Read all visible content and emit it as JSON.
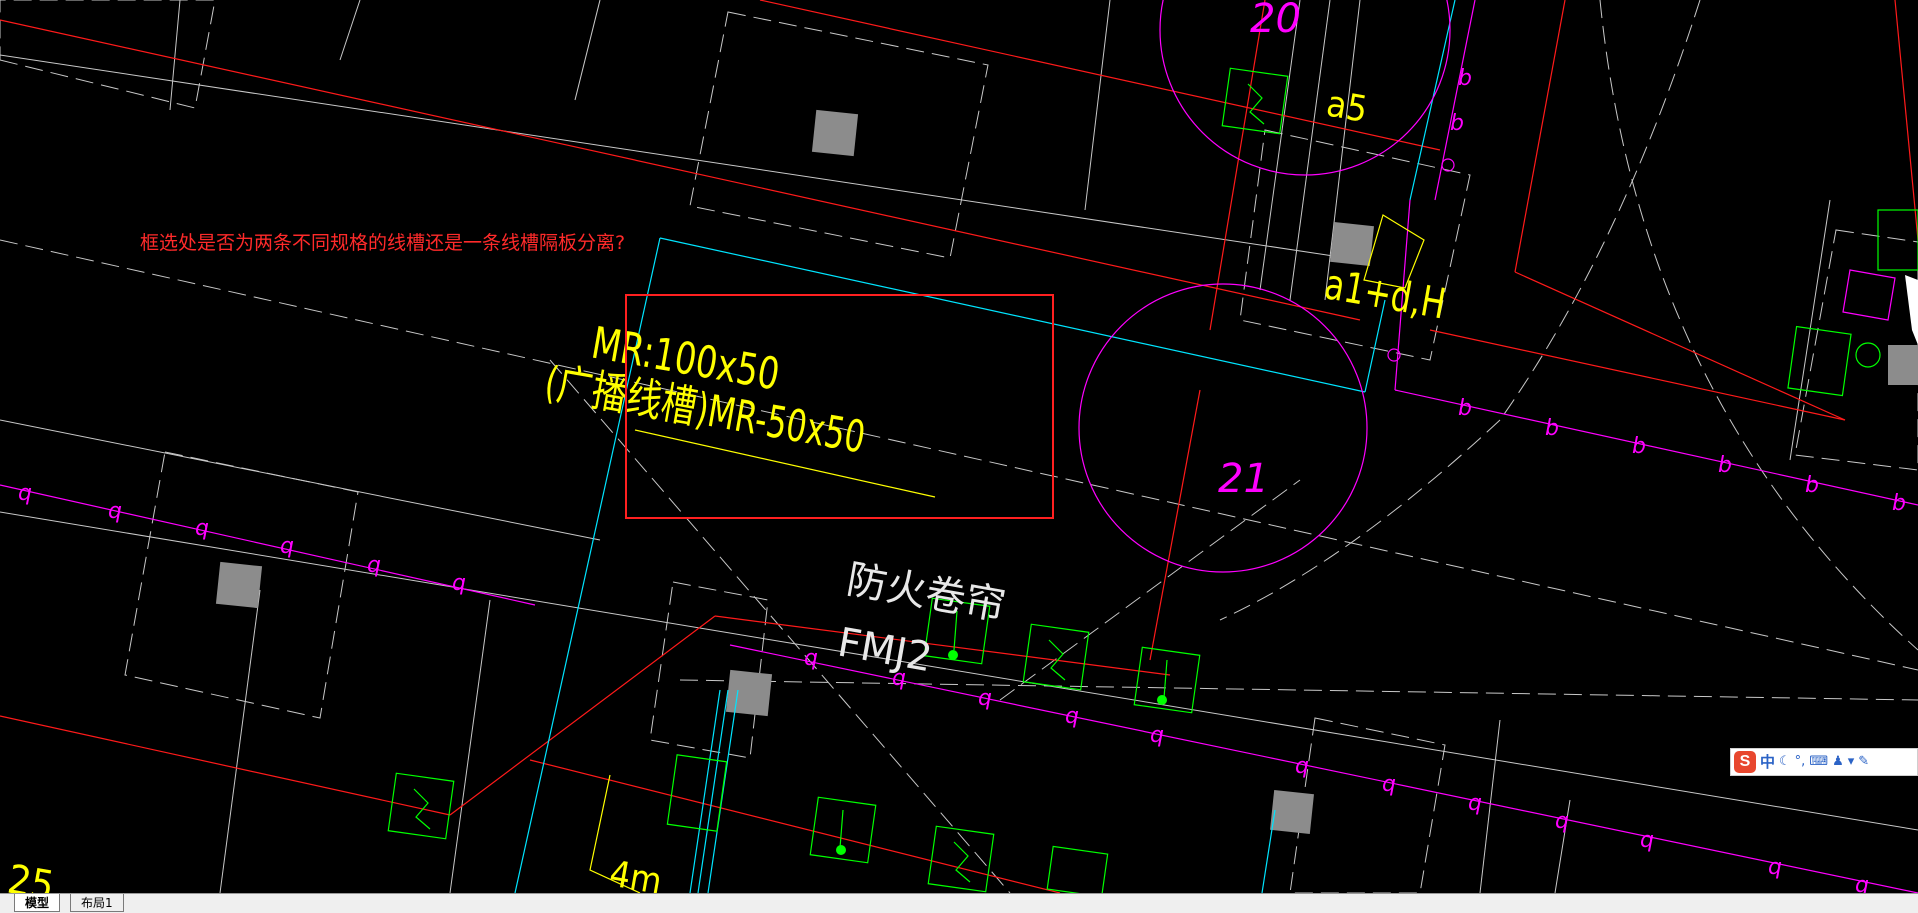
{
  "annotation": {
    "question": "框选处是否为两条不同规格的线槽还是一条线槽隔板分离?",
    "question_color": "#ff2a2a",
    "box_color": "#ff2020"
  },
  "drawing_labels": {
    "tray_main": "MR:100x50",
    "tray_broadcast": "(广播线槽)MR-50x50",
    "fire_shutter": "防火卷帘",
    "fire_shutter_code": "FMJ2",
    "room_21": "21",
    "room_20": "20",
    "tag_a5": "a5",
    "tag_a1dH": "a1+d,H",
    "height_4m": "4m",
    "room_25": "25",
    "line_marker_q": "q",
    "line_marker_b": "b"
  },
  "colors": {
    "background": "#000000",
    "white_line": "#c8c8c8",
    "red_line": "#ff1a1a",
    "magenta_line": "#ff00ff",
    "cyan_line": "#00e5ff",
    "yellow_text": "#ffff00",
    "green_symbol": "#00ff00",
    "gray_column": "#8c8c8c"
  },
  "tabs": [
    {
      "label": "模型",
      "active": true
    },
    {
      "label": "布局1",
      "active": false
    }
  ],
  "ime_toolbar": {
    "logo": "S",
    "mode": "中",
    "icons": [
      "moon-icon",
      "punctuation-icon",
      "keyboard-icon",
      "user-icon",
      "skin-icon",
      "wrench-icon"
    ]
  }
}
